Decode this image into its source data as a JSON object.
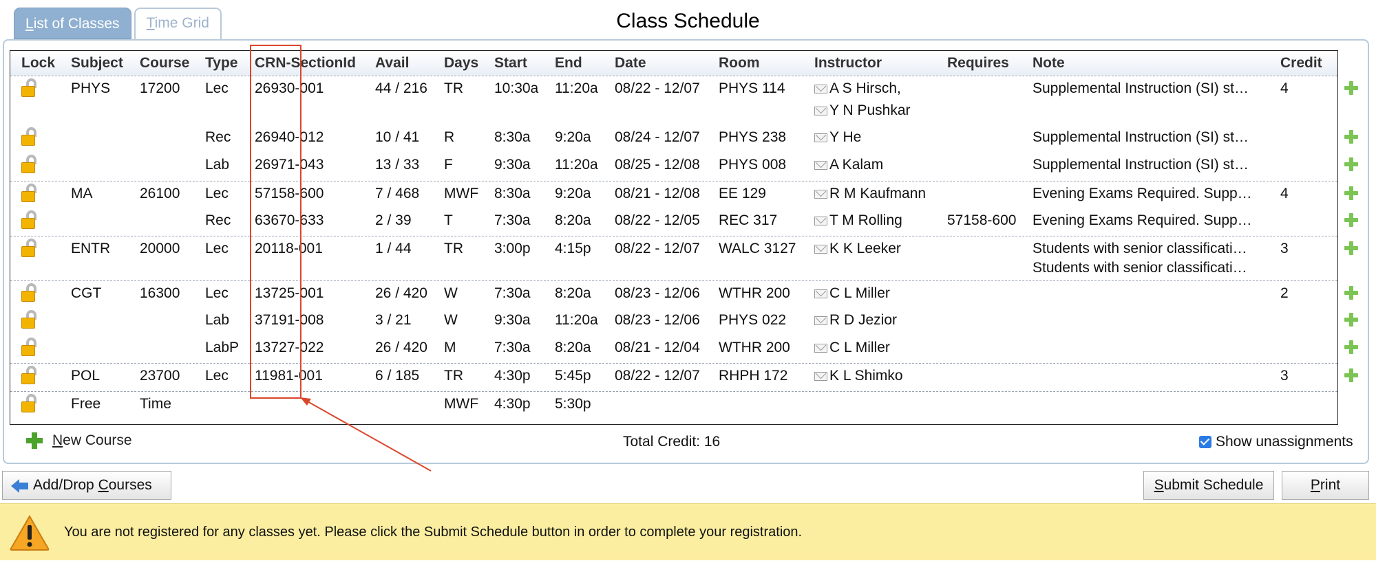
{
  "tabs": {
    "list": {
      "prefix": "L",
      "rest": "ist of Classes"
    },
    "grid": {
      "prefix": "T",
      "rest": "ime Grid"
    }
  },
  "title": "Class Schedule",
  "headers": [
    "Lock",
    "Subject",
    "Course",
    "Type",
    "CRN-SectionId",
    "Avail",
    "Days",
    "Start",
    "End",
    "Date",
    "Room",
    "Instructor",
    "Requires",
    "Note",
    "Credit"
  ],
  "rows": [
    {
      "subject": "PHYS",
      "course": "17200",
      "type": "Lec",
      "crn": "26930-001",
      "avail": "44 / 216",
      "days": "TR",
      "start": "10:30a",
      "end": "11:20a",
      "date": "08/22 - 12/07",
      "room": "PHYS 114",
      "instructor": "A S Hirsch,",
      "instructor2": "Y N Pushkar",
      "requires": "",
      "note": "Supplemental Instruction (SI) st…",
      "credit": "4"
    },
    {
      "subject": "",
      "course": "",
      "type": "Rec",
      "crn": "26940-012",
      "avail": "10 / 41",
      "days": "R",
      "start": "8:30a",
      "end": "9:20a",
      "date": "08/24 - 12/07",
      "room": "PHYS 238",
      "instructor": "Y He",
      "requires": "",
      "note": "Supplemental Instruction (SI) st…",
      "credit": ""
    },
    {
      "subject": "",
      "course": "",
      "type": "Lab",
      "crn": "26971-043",
      "avail": "13 / 33",
      "days": "F",
      "start": "9:30a",
      "end": "11:20a",
      "date": "08/25 - 12/08",
      "room": "PHYS 008",
      "instructor": "A Kalam",
      "requires": "",
      "note": "Supplemental Instruction (SI) st…",
      "credit": ""
    },
    {
      "subject": "MA",
      "course": "26100",
      "type": "Lec",
      "crn": "57158-600",
      "avail": "7 / 468",
      "days": "MWF",
      "start": "8:30a",
      "end": "9:20a",
      "date": "08/21 - 12/08",
      "room": "EE 129",
      "instructor": "R M Kaufmann",
      "requires": "",
      "note": "Evening Exams Required. Supp…",
      "credit": "4"
    },
    {
      "subject": "",
      "course": "",
      "type": "Rec",
      "crn": "63670-633",
      "avail": "2 / 39",
      "days": "T",
      "start": "7:30a",
      "end": "8:20a",
      "date": "08/22 - 12/05",
      "room": "REC 317",
      "instructor": "T M Rolling",
      "requires": "57158-600",
      "note": "Evening Exams Required. Supp…",
      "credit": ""
    },
    {
      "subject": "ENTR",
      "course": "20000",
      "type": "Lec",
      "crn": "20118-001",
      "avail": "1 / 44",
      "days": "TR",
      "start": "3:00p",
      "end": "4:15p",
      "date": "08/22 - 12/07",
      "room": "WALC 3127",
      "instructor": "K K Leeker",
      "requires": "",
      "note": "Students with senior classificati…",
      "note2": "Students with senior classificati…",
      "credit": "3"
    },
    {
      "subject": "CGT",
      "course": "16300",
      "type": "Lec",
      "crn": "13725-001",
      "avail": "26 / 420",
      "days": "W",
      "start": "7:30a",
      "end": "8:20a",
      "date": "08/23 - 12/06",
      "room": "WTHR 200",
      "instructor": "C L Miller",
      "requires": "",
      "note": "",
      "credit": "2"
    },
    {
      "subject": "",
      "course": "",
      "type": "Lab",
      "crn": "37191-008",
      "avail": "3 / 21",
      "days": "W",
      "start": "9:30a",
      "end": "11:20a",
      "date": "08/23 - 12/06",
      "room": "PHYS 022",
      "instructor": "R D Jezior",
      "requires": "",
      "note": "",
      "credit": ""
    },
    {
      "subject": "",
      "course": "",
      "type": "LabP",
      "crn": "13727-022",
      "avail": "26 / 420",
      "days": "M",
      "start": "7:30a",
      "end": "8:20a",
      "date": "08/21 - 12/04",
      "room": "WTHR 200",
      "instructor": "C L Miller",
      "requires": "",
      "note": "",
      "credit": ""
    },
    {
      "subject": "POL",
      "course": "23700",
      "type": "Lec",
      "crn": "11981-001",
      "avail": "6 / 185",
      "days": "TR",
      "start": "4:30p",
      "end": "5:45p",
      "date": "08/22 - 12/07",
      "room": "RHPH 172",
      "instructor": "K L Shimko",
      "requires": "",
      "note": "",
      "credit": "3"
    }
  ],
  "free_time": {
    "subject": "Free",
    "course": "Time",
    "days": "MWF",
    "start": "4:30p",
    "end": "5:30p"
  },
  "footer": {
    "new_course_prefix": "N",
    "new_course_rest": "ew Course",
    "total_credit": "Total Credit: 16",
    "show_unassignments": "Show unassignments"
  },
  "buttons": {
    "add_drop": {
      "a": "Add/Drop ",
      "u": "C",
      "b": "ourses"
    },
    "submit": {
      "u": "S",
      "rest": "ubmit Schedule"
    },
    "print": {
      "u": "P",
      "rest": "rint"
    }
  },
  "warning": "You are not registered for any classes yet. Please click the Submit Schedule button in order to complete your registration.",
  "colors": {
    "tab_active": "#8fb0d0",
    "frame_border": "#b7cadb",
    "lock_body": "#f3b400",
    "add_icon": "#7cc454",
    "warning_bg": "#fbeea0",
    "annotation": "#d9472b"
  }
}
